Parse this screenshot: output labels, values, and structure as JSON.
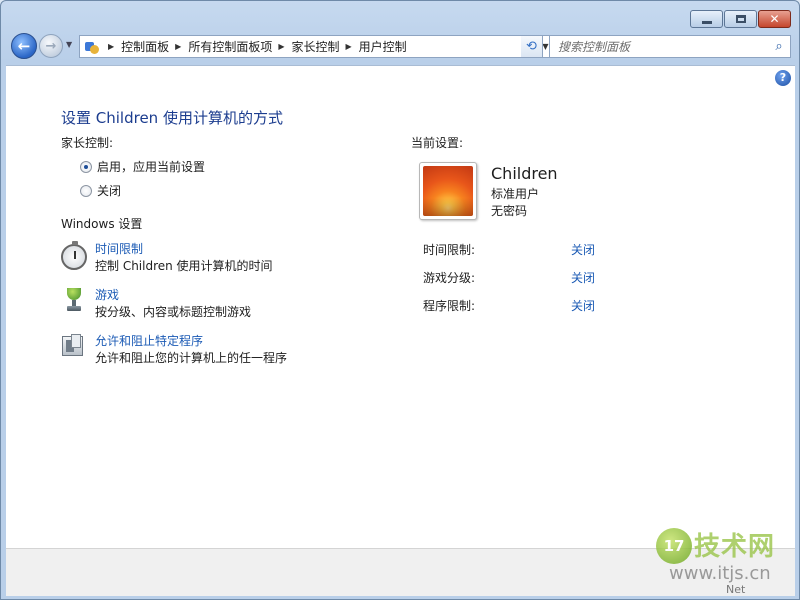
{
  "window": {
    "caption": {
      "minimize": "–",
      "close": "✕"
    }
  },
  "nav": {
    "back_glyph": "←",
    "forward_glyph": "→",
    "history_glyph": "▼",
    "address_icon": "control-panel-icon",
    "breadcrumbs": [
      "控制面板",
      "所有控制面板项",
      "家长控制",
      "用户控制"
    ],
    "crumb_separator": "▶",
    "address_dropdown": "▼",
    "refresh_glyph": "⟲",
    "search_placeholder": "搜索控制面板",
    "search_glyph": "⌕"
  },
  "help": {
    "label": "?"
  },
  "main": {
    "title": "设置 Children 使用计算机的方式",
    "parental_label": "家长控制:",
    "radio_on": "启用，应用当前设置",
    "radio_off": "关闭",
    "radio_selected": "on",
    "windows_settings_label": "Windows 设置",
    "tasks": [
      {
        "icon": "stopwatch-icon",
        "link": "时间限制",
        "desc": "控制 Children 使用计算机的时间"
      },
      {
        "icon": "trophy-icon",
        "link": "游戏",
        "desc": "按分级、内容或标题控制游戏"
      },
      {
        "icon": "program-icon",
        "link": "允许和阻止特定程序",
        "desc": "允许和阻止您的计算机上的任一程序"
      }
    ]
  },
  "current": {
    "label": "当前设置:",
    "user_name": "Children",
    "user_type": "标准用户",
    "password": "无密码",
    "settings": [
      {
        "key": "时间限制:",
        "value": "关闭"
      },
      {
        "key": "游戏分级:",
        "value": "关闭"
      },
      {
        "key": "程序限制:",
        "value": "关闭"
      }
    ]
  },
  "watermark": {
    "badge": "17",
    "title": "技术网",
    "url": "www.itjs.cn",
    "small": "Net"
  }
}
